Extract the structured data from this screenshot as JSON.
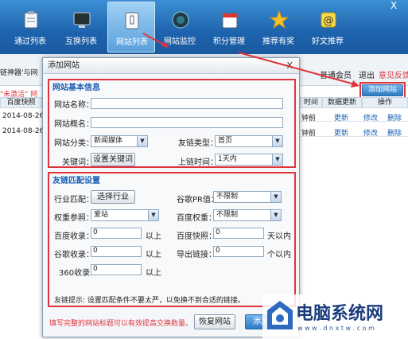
{
  "toolbar": {
    "items": [
      {
        "label": "通过列表",
        "icon": "clipboard-icon"
      },
      {
        "label": "互换列表",
        "icon": "monitor-icon"
      },
      {
        "label": "网站列表",
        "icon": "document-icon"
      },
      {
        "label": "网站监控",
        "icon": "globe-icon"
      },
      {
        "label": "积分管理",
        "icon": "calendar-icon"
      },
      {
        "label": "推荐有奖",
        "icon": "star-icon"
      },
      {
        "label": "好文推荐",
        "icon": "at-icon"
      }
    ],
    "close": "X"
  },
  "background": {
    "left_title": "链神器'与网",
    "left_warning": "\"未激活\" 网",
    "col_baidu": "百度快照",
    "dates": [
      "2014-08-26",
      "2014-08-26"
    ],
    "user_type": "普通会员",
    "logout": "退出",
    "feedback": "意见反馈",
    "add_site_button": "添加网站",
    "headers": [
      "时间",
      "数据更新",
      "操作"
    ],
    "rows": [
      {
        "time": "钟前",
        "update": "更新",
        "edit": "修改",
        "delete": "删除"
      },
      {
        "time": "钟前",
        "update": "更新",
        "edit": "修改",
        "delete": "删除"
      }
    ]
  },
  "dialog": {
    "title": "添加网站",
    "close": "X",
    "basic": {
      "title": "网站基本信息",
      "site_name_label": "网站名称：",
      "site_name_value": "",
      "alias_label": "网站概名：",
      "alias_value": "",
      "category_label": "网站分类：",
      "category_value": "新闻媒体",
      "link_type_label": "友链类型：",
      "link_type_value": "首页",
      "keywords_label": "关键词：",
      "keywords_button": "设置关键词",
      "online_time_label": "上链时间：",
      "online_time_value": "1天内"
    },
    "match": {
      "title": "友链匹配设置",
      "industry_label": "行业匹配：",
      "industry_button": "选择行业",
      "google_pr_label": "谷歌PR值：",
      "google_pr_value": "不限制",
      "weight_ref_label": "权重参照：",
      "weight_ref_value": "爱站",
      "baidu_weight_label": "百度权重：",
      "baidu_weight_value": "不限制",
      "baidu_index_label": "百度收录：",
      "baidu_index_value": "0",
      "baidu_index_unit": "以上",
      "baidu_snapshot_label": "百度快照：",
      "baidu_snapshot_value": "0",
      "baidu_snapshot_unit": "天以内",
      "google_index_label": "谷歌收录：",
      "google_index_value": "0",
      "google_index_unit": "以上",
      "outlinks_label": "导出链接：",
      "outlinks_value": "0",
      "outlinks_unit": "个以内",
      "index360_label": "360收录：",
      "index360_value": "0",
      "index360_unit": "以上",
      "tip": "友链提示: 设置匹配条件不要太严，以免换不到合适的链接。"
    },
    "footer_warning": "填写完整的网站标题可以有效提高交换数量。",
    "restore_button": "恢复网站",
    "add_button": "添加"
  },
  "watermark": {
    "brand": "电脑系统网",
    "url": "w w w . d n x t w . c o m"
  },
  "colors": {
    "toolbar": "#1d63ad",
    "highlight_red": "#e0343c",
    "link_blue": "#1a5fb4"
  }
}
